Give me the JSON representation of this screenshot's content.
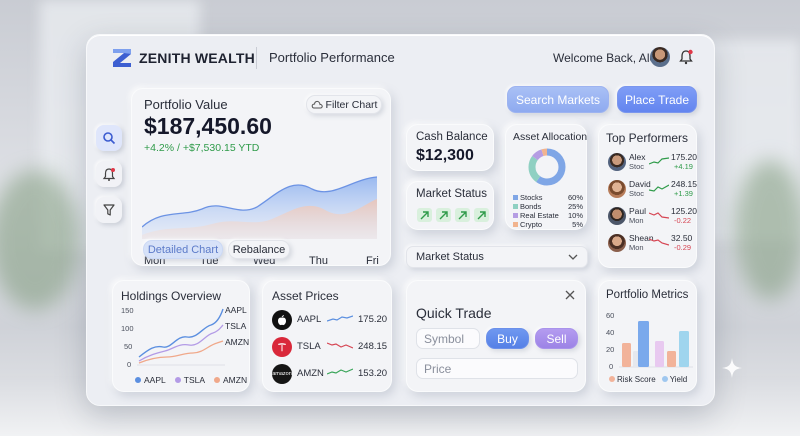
{
  "header": {
    "brand": "ZENITH WEALTH",
    "page_title": "Portfolio Performance",
    "welcome": "Welcome Back, Alex"
  },
  "actions": {
    "search_markets": "Search Markets",
    "place_trade": "Place Trade"
  },
  "portfolio_value": {
    "title": "Portfolio Value",
    "filter_label": "Filter Chart",
    "value": "$187,450.60",
    "change": "+4.2% / +$7,530.15 YTD",
    "days": [
      "Mon",
      "Tue",
      "Wed",
      "Thu",
      "Fri"
    ],
    "detailed_chart": "Detailed Chart",
    "rebalance": "Rebalance"
  },
  "cash_balance": {
    "title": "Cash Balance",
    "value": "$12,300"
  },
  "market_status": {
    "title": "Market Status",
    "dropdown_label": "Market Status"
  },
  "asset_allocation": {
    "title": "Asset Allocation",
    "items": [
      {
        "label": "Stocks",
        "value": "60%",
        "color": "#7fa6e6"
      },
      {
        "label": "Bonds",
        "value": "25%",
        "color": "#8fd0c2"
      },
      {
        "label": "Real Estate",
        "value": "10%",
        "color": "#b59de3"
      },
      {
        "label": "Crypto",
        "value": "5%",
        "color": "#f1b48f"
      }
    ]
  },
  "top_performers": {
    "title": "Top Performers",
    "items": [
      {
        "name": "Alex",
        "sub": "Stoc",
        "price": "175.20",
        "change": "+4.19",
        "up": true
      },
      {
        "name": "David",
        "sub": "Stoc",
        "price": "248.15",
        "change": "+1.39",
        "up": true
      },
      {
        "name": "Paul",
        "sub": "Mon",
        "price": "125.20",
        "change": "-0.22",
        "up": false
      },
      {
        "name": "Shean",
        "sub": "Mon",
        "price": "32.50",
        "change": "-0.29",
        "up": false
      }
    ]
  },
  "holdings": {
    "title": "Holdings Overview",
    "yticks": [
      "150",
      "100",
      "50",
      "0"
    ],
    "series_labels": [
      "AAPL",
      "TSLA",
      "AMZN"
    ],
    "legend": [
      "AAPL",
      "TSLA",
      "AMZN"
    ],
    "legend_colors": [
      "#5b8fe0",
      "#b39be6",
      "#f0a88a"
    ]
  },
  "asset_prices": {
    "title": "Asset Prices",
    "items": [
      {
        "symbol": "AAPL",
        "price": "175.20",
        "logo": "apple-logo",
        "trend": "up",
        "color": "#5b8fe0"
      },
      {
        "symbol": "TSLA",
        "price": "248.15",
        "logo": "tesla-logo",
        "trend": "down",
        "color": "#d64553"
      },
      {
        "symbol": "AMZN",
        "price": "153.20",
        "logo": "amazon-logo",
        "logo_text": "amazon",
        "trend": "up",
        "color": "#3aa55a"
      }
    ]
  },
  "quick_trade": {
    "title": "Quick Trade",
    "symbol_placeholder": "Symbol",
    "buy": "Buy",
    "sell": "Sell",
    "price_placeholder": "Price"
  },
  "portfolio_metrics": {
    "title": "Portfolio Metrics",
    "yticks": [
      "60",
      "40",
      "20",
      "0"
    ],
    "legend": [
      "Risk Score",
      "Yield"
    ],
    "legend_colors": [
      "#f2b39a",
      "#9fc7ef"
    ]
  }
}
